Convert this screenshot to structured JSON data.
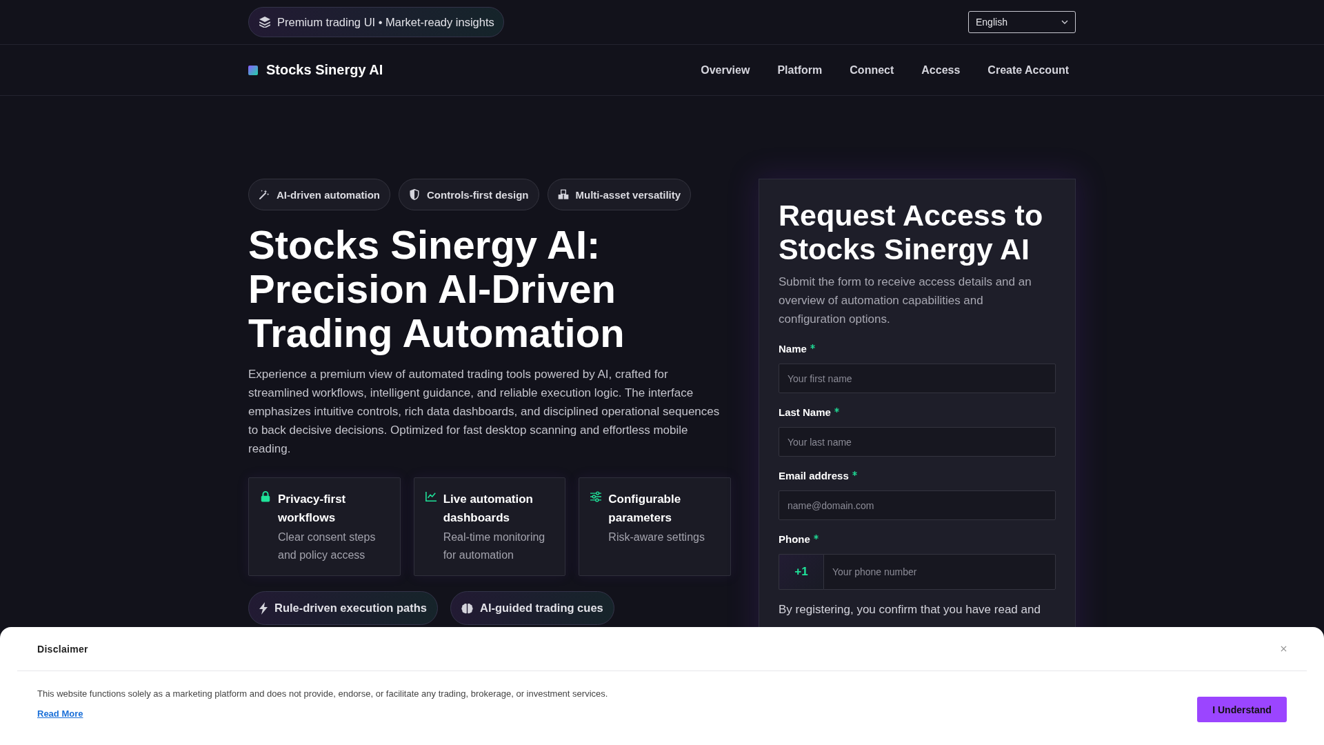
{
  "top_bar": {
    "announcement": "Premium trading UI • Market-ready insights",
    "language_select": {
      "value": "English"
    }
  },
  "nav": {
    "brand": "Stocks Sinergy AI",
    "links": [
      "Overview",
      "Platform",
      "Connect",
      "Access",
      "Create Account"
    ]
  },
  "hero": {
    "tags": [
      "AI-driven automation",
      "Controls-first design",
      "Multi-asset versatility"
    ],
    "title": "Stocks Sinergy AI: Precision AI-Driven Trading Automation",
    "description": "Experience a premium view of automated trading tools powered by AI, crafted for streamlined workflows, intelligent guidance, and reliable execution logic. The interface emphasizes intuitive controls, rich data dashboards, and disciplined operational sequences to back decisive decisions. Optimized for fast desktop scanning and effortless mobile reading.",
    "features": [
      {
        "title": "Privacy-first workflows",
        "text": "Clear consent steps and policy access"
      },
      {
        "title": "Live automation dashboards",
        "text": "Real-time monitoring for automation"
      },
      {
        "title": "Configurable parameters",
        "text": "Risk-aware settings"
      }
    ],
    "highlights": [
      "Rule-driven execution paths",
      "AI-guided trading cues"
    ]
  },
  "access_form": {
    "title": "Request Access to Stocks Sinergy AI",
    "subtitle": "Submit the form to receive access details and an overview of automation capabilities and configuration options.",
    "fields": [
      {
        "kind": "text",
        "label": "Name",
        "required": true,
        "placeholder": "Your first name"
      },
      {
        "kind": "text",
        "label": "Last Name",
        "required": true,
        "placeholder": "Your last name"
      },
      {
        "kind": "text",
        "label": "Email address",
        "required": true,
        "placeholder": "name@domain.com"
      },
      {
        "kind": "phone",
        "label": "Phone",
        "required": true,
        "prefix": "+1",
        "placeholder": "Your phone number"
      }
    ],
    "consent": "By registering, you confirm that you have read and"
  },
  "disclaimer": {
    "title": "Disclaimer",
    "text": "This website functions solely as a marketing platform and does not provide, endorse, or facilitate any trading, brokerage, or investment services.",
    "link": "Read More",
    "button": "I Understand"
  }
}
